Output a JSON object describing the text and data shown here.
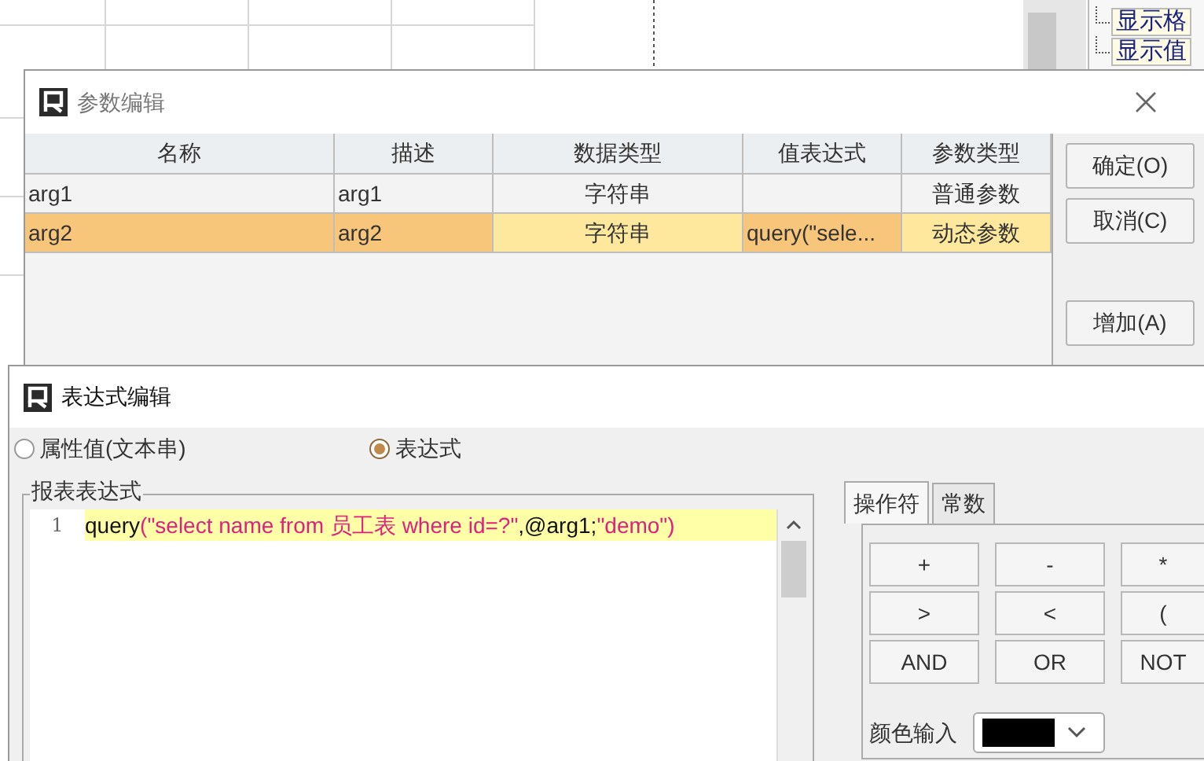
{
  "tree_panel": {
    "items": [
      "显示格",
      "显示值"
    ]
  },
  "param_dialog": {
    "title": "参数编辑",
    "columns": [
      "名称",
      "描述",
      "数据类型",
      "值表达式",
      "参数类型"
    ],
    "rows": [
      {
        "cells": [
          "arg1",
          "arg1",
          "字符串",
          "",
          "普通参数"
        ],
        "selected": false
      },
      {
        "cells": [
          "arg2",
          "arg2",
          "字符串",
          "query(\"sele...",
          "动态参数"
        ],
        "selected": true
      }
    ],
    "buttons": [
      "确定(O)",
      "取消(C)",
      "增加(A)"
    ]
  },
  "expr_dialog": {
    "title": "表达式编辑",
    "modes": [
      {
        "label": "属性值(文本串)",
        "selected": false
      },
      {
        "label": "表达式",
        "selected": true
      }
    ],
    "group_label": "报表表达式",
    "line_number": "1",
    "code": [
      {
        "kind": "plain",
        "text": "query"
      },
      {
        "kind": "string",
        "text": "(\"select name from 员工表 where id=?\""
      },
      {
        "kind": "plain",
        "text": ",@arg1;"
      },
      {
        "kind": "string",
        "text": "\"demo\")"
      }
    ],
    "tabs": [
      {
        "label": "操作符",
        "selected": true
      },
      {
        "label": "常数",
        "selected": false
      }
    ],
    "operators": [
      "+",
      "-",
      "*",
      ">",
      "<",
      "(",
      "AND",
      "OR",
      "NOT"
    ],
    "color_label": "颜色输入",
    "color": "#000000"
  }
}
